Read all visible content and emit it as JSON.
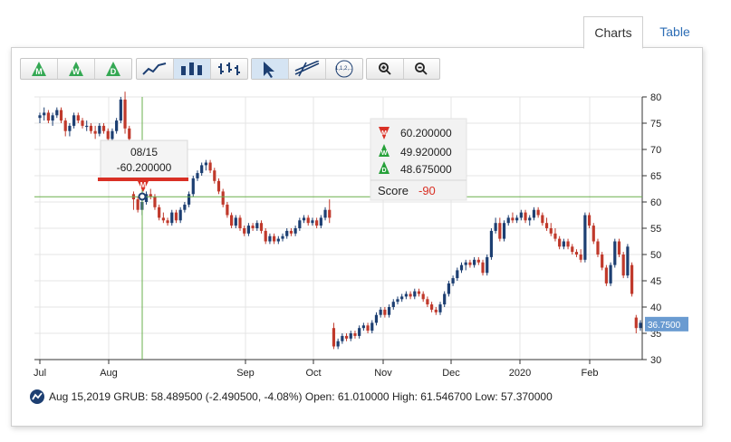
{
  "tabs": {
    "charts": "Charts",
    "table": "Table"
  },
  "toolbar": {
    "period_buttons": [
      "M",
      "W",
      "D"
    ],
    "chart_type_icons": [
      "line-chart-icon",
      "bar-chart-icon",
      "ohlc-chart-icon"
    ],
    "tool_icons": [
      "pointer-icon",
      "trendline-icon",
      "fibonacci-icon"
    ],
    "fib_label": "1,1,2,...",
    "zoom_icons": [
      "zoom-in-icon",
      "zoom-out-icon"
    ]
  },
  "crosshair_label": {
    "date": "08/15",
    "value": "-60.200000"
  },
  "score_box": {
    "rows": [
      {
        "letter": "M",
        "value": "60.200000"
      },
      {
        "letter": "W",
        "value": "49.920000"
      },
      {
        "letter": "D",
        "value": "48.675000"
      }
    ],
    "score_label": "Score",
    "score_value": "-90"
  },
  "marker_letter": "M",
  "last_price_label": "36.7500",
  "footer_text": "Aug 15,2019 GRUB: 58.489500 (-2.490500, -4.08%) Open: 61.010000 High: 61.546700 Low: 57.370000",
  "colors": {
    "up": "#1d3f72",
    "down": "#c0392b",
    "crosshair": "#6ab04c",
    "label_bg": "#6a9bd1",
    "accent": "#2d6db5",
    "signal_green": "#27a13a",
    "signal_red": "#d93025"
  },
  "chart_data": {
    "type": "candlestick",
    "ylim": [
      30,
      80
    ],
    "y_ticks": [
      30,
      35,
      40,
      45,
      50,
      55,
      60,
      65,
      70,
      75,
      80
    ],
    "x_tick_labels": [
      "Jul",
      "Aug",
      "Sep",
      "Oct",
      "Nov",
      "Dec",
      "2020",
      "Feb"
    ],
    "crosshair": {
      "date": "08/15",
      "y": 61
    },
    "last_price": 36.75,
    "points": [
      [
        76,
        77,
        75,
        76.5
      ],
      [
        76.5,
        78,
        75.5,
        77
      ],
      [
        77,
        77.5,
        75,
        75.5
      ],
      [
        75.5,
        77,
        74.5,
        76.5
      ],
      [
        76.5,
        78,
        76,
        77.5
      ],
      [
        77.5,
        78,
        75,
        75.5
      ],
      [
        75.5,
        76,
        72.5,
        73.5
      ],
      [
        73.5,
        75,
        72.5,
        74.5
      ],
      [
        74.5,
        77,
        74,
        76.5
      ],
      [
        76.5,
        77,
        75,
        75.5
      ],
      [
        75.5,
        76,
        74,
        74.5
      ],
      [
        74.5,
        75.5,
        73.5,
        74.5
      ],
      [
        74.5,
        75,
        73,
        73.5
      ],
      [
        73.5,
        74.5,
        72,
        73
      ],
      [
        73,
        75,
        72.5,
        74.5
      ],
      [
        74.5,
        75,
        73,
        73.5
      ],
      [
        73.5,
        74,
        71.5,
        72
      ],
      [
        72,
        74,
        71.5,
        73.5
      ],
      [
        73.5,
        76,
        73,
        75.5
      ],
      [
        75.5,
        80,
        75,
        79.5
      ],
      [
        79.5,
        81,
        73,
        74
      ],
      [
        74,
        74.5,
        71.5,
        72
      ],
      [
        61.5,
        62,
        58.5,
        60.5
      ],
      [
        60.5,
        61,
        58,
        58.5
      ],
      [
        58.5,
        60.5,
        57.5,
        60
      ],
      [
        60,
        62,
        59.5,
        61.5
      ],
      [
        61.5,
        62.5,
        60.5,
        61
      ],
      [
        61,
        61.5,
        58.5,
        59
      ],
      [
        59,
        59.5,
        56.5,
        57
      ],
      [
        57,
        58,
        56,
        56.5
      ],
      [
        56.5,
        57,
        55.5,
        56
      ],
      [
        56,
        58.5,
        55.5,
        58
      ],
      [
        58,
        58.5,
        56,
        56.5
      ],
      [
        56.5,
        59,
        56,
        58.5
      ],
      [
        58.5,
        60,
        58,
        59.5
      ],
      [
        59.5,
        62,
        59,
        61.5
      ],
      [
        61.5,
        65,
        61,
        64.5
      ],
      [
        64.5,
        66,
        64,
        65.5
      ],
      [
        65.5,
        67.5,
        65,
        67
      ],
      [
        67,
        68,
        66,
        67.5
      ],
      [
        67.5,
        68,
        65.5,
        66
      ],
      [
        66,
        66.5,
        63.5,
        64
      ],
      [
        64,
        64.5,
        61.5,
        62
      ],
      [
        62,
        62.5,
        59,
        59.5
      ],
      [
        59.5,
        60,
        57,
        57.5
      ],
      [
        57.5,
        58,
        55,
        55.5
      ],
      [
        55.5,
        57.5,
        55,
        57
      ],
      [
        57,
        57.5,
        54.5,
        55
      ],
      [
        55,
        55.5,
        53.5,
        54
      ],
      [
        54,
        56,
        53.5,
        55.5
      ],
      [
        55.5,
        56,
        54.5,
        55
      ],
      [
        55,
        56.5,
        54.5,
        56
      ],
      [
        56,
        56.5,
        54,
        54.5
      ],
      [
        54.5,
        55,
        52,
        52.5
      ],
      [
        52.5,
        54,
        52,
        53.5
      ],
      [
        53.5,
        54,
        52,
        52.5
      ],
      [
        52.5,
        53.5,
        52,
        53
      ],
      [
        53,
        54,
        52.5,
        53.5
      ],
      [
        53.5,
        55,
        53,
        54.5
      ],
      [
        54.5,
        55,
        53.5,
        54
      ],
      [
        54,
        55.5,
        53.5,
        55
      ],
      [
        55,
        57,
        54.5,
        56.5
      ],
      [
        56.5,
        57.5,
        56,
        57
      ],
      [
        57,
        57.5,
        55.5,
        56
      ],
      [
        56,
        57,
        55.5,
        56.5
      ],
      [
        56.5,
        57,
        55,
        55.5
      ],
      [
        55.5,
        57.5,
        55,
        57
      ],
      [
        57,
        59,
        56.5,
        58.5
      ],
      [
        58.5,
        60.5,
        56,
        57
      ],
      [
        36,
        37,
        32,
        32.5
      ],
      [
        32.5,
        34,
        32,
        33.5
      ],
      [
        33.5,
        35,
        33,
        34.5
      ],
      [
        34.5,
        35,
        33.5,
        34
      ],
      [
        34,
        35.5,
        33.5,
        35
      ],
      [
        35,
        35.5,
        34,
        34.5
      ],
      [
        34.5,
        36.5,
        34,
        36
      ],
      [
        36,
        37,
        35.5,
        36.5
      ],
      [
        36.5,
        37,
        35,
        35.5
      ],
      [
        35.5,
        37.5,
        35,
        37
      ],
      [
        37,
        39,
        36.5,
        38.5
      ],
      [
        38.5,
        40,
        38,
        39.5
      ],
      [
        39.5,
        40,
        38,
        38.5
      ],
      [
        38.5,
        40.5,
        38,
        40
      ],
      [
        40,
        41.5,
        39.5,
        41
      ],
      [
        41,
        42,
        40.5,
        41.5
      ],
      [
        41.5,
        42.5,
        41,
        42
      ],
      [
        42,
        43,
        41.5,
        42.5
      ],
      [
        42.5,
        43,
        41.5,
        42
      ],
      [
        42,
        43.5,
        41.5,
        43
      ],
      [
        43,
        43.5,
        42,
        42.5
      ],
      [
        42.5,
        43,
        41,
        41.5
      ],
      [
        41.5,
        42,
        40,
        40.5
      ],
      [
        40.5,
        41,
        39,
        39.5
      ],
      [
        39.5,
        40,
        38.5,
        39
      ],
      [
        39,
        41,
        38.5,
        40.5
      ],
      [
        40.5,
        43,
        40,
        42.5
      ],
      [
        42.5,
        45,
        42,
        44.5
      ],
      [
        44.5,
        46,
        44,
        45.5
      ],
      [
        45.5,
        47.5,
        45,
        47
      ],
      [
        47,
        48.5,
        46.5,
        48
      ],
      [
        48,
        49,
        47,
        48.5
      ],
      [
        48.5,
        49,
        47.5,
        48
      ],
      [
        48,
        49.5,
        47.5,
        49
      ],
      [
        49,
        49.5,
        48,
        48.5
      ],
      [
        48.5,
        49,
        46,
        46.5
      ],
      [
        46.5,
        50,
        46,
        49.5
      ],
      [
        49.5,
        55,
        49,
        54.5
      ],
      [
        54.5,
        57,
        54,
        56
      ],
      [
        56,
        57,
        52.5,
        53
      ],
      [
        53,
        56.5,
        52.5,
        56
      ],
      [
        56,
        57.5,
        55.5,
        57
      ],
      [
        57,
        58,
        56,
        56.5
      ],
      [
        56.5,
        57.5,
        56,
        57
      ],
      [
        57,
        58.5,
        56.5,
        58
      ],
      [
        58,
        58.5,
        56,
        56.5
      ],
      [
        56.5,
        57.5,
        55.5,
        57
      ],
      [
        57,
        59,
        56.5,
        58.5
      ],
      [
        58.5,
        59,
        57,
        57.5
      ],
      [
        57.5,
        58,
        55.5,
        56
      ],
      [
        56,
        57,
        54.5,
        55
      ],
      [
        55,
        56,
        53.5,
        54
      ],
      [
        54,
        55,
        52.5,
        53
      ],
      [
        53,
        53.5,
        51,
        51.5
      ],
      [
        51.5,
        53,
        51,
        52.5
      ],
      [
        52.5,
        53,
        51,
        51.5
      ],
      [
        51.5,
        52,
        50,
        50.5
      ],
      [
        50.5,
        51,
        49.5,
        50
      ],
      [
        50,
        51,
        48.5,
        49
      ],
      [
        49,
        58,
        48.5,
        57.5
      ],
      [
        57.5,
        58,
        55,
        55.5
      ],
      [
        55.5,
        56,
        52,
        52.5
      ],
      [
        52.5,
        53,
        49.5,
        50
      ],
      [
        50,
        50.5,
        47,
        47.5
      ],
      [
        47.5,
        48,
        44,
        44.5
      ],
      [
        44.5,
        48.5,
        44,
        48
      ],
      [
        48,
        53,
        47.5,
        52.5
      ],
      [
        52.5,
        53,
        49.5,
        50
      ],
      [
        50,
        50.5,
        45.5,
        46
      ],
      [
        46,
        52,
        45.5,
        51.5
      ],
      [
        48,
        48.5,
        42,
        42.5
      ],
      [
        38,
        38.5,
        35,
        36
      ],
      [
        36,
        37.5,
        35.5,
        37
      ]
    ]
  }
}
